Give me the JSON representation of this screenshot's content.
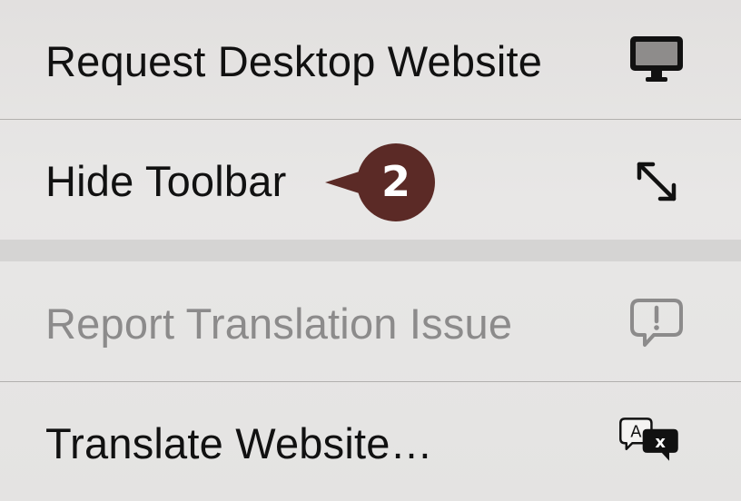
{
  "menu": {
    "items": [
      {
        "label": "Request Desktop Website",
        "icon": "desktop-icon",
        "enabled": true
      },
      {
        "label": "Hide Toolbar",
        "icon": "resize-arrows-icon",
        "enabled": true
      },
      {
        "label": "Report Translation Issue",
        "icon": "report-issue-icon",
        "enabled": false
      },
      {
        "label": "Translate Website…",
        "icon": "translate-icon",
        "enabled": true
      }
    ]
  },
  "callout": {
    "number": "2",
    "color": "#5b2a26"
  },
  "colors": {
    "text": "#111111",
    "disabled_text": "#8c8b8b",
    "divider": "#b2b0ae",
    "group_separator": "#d5d4d3"
  }
}
